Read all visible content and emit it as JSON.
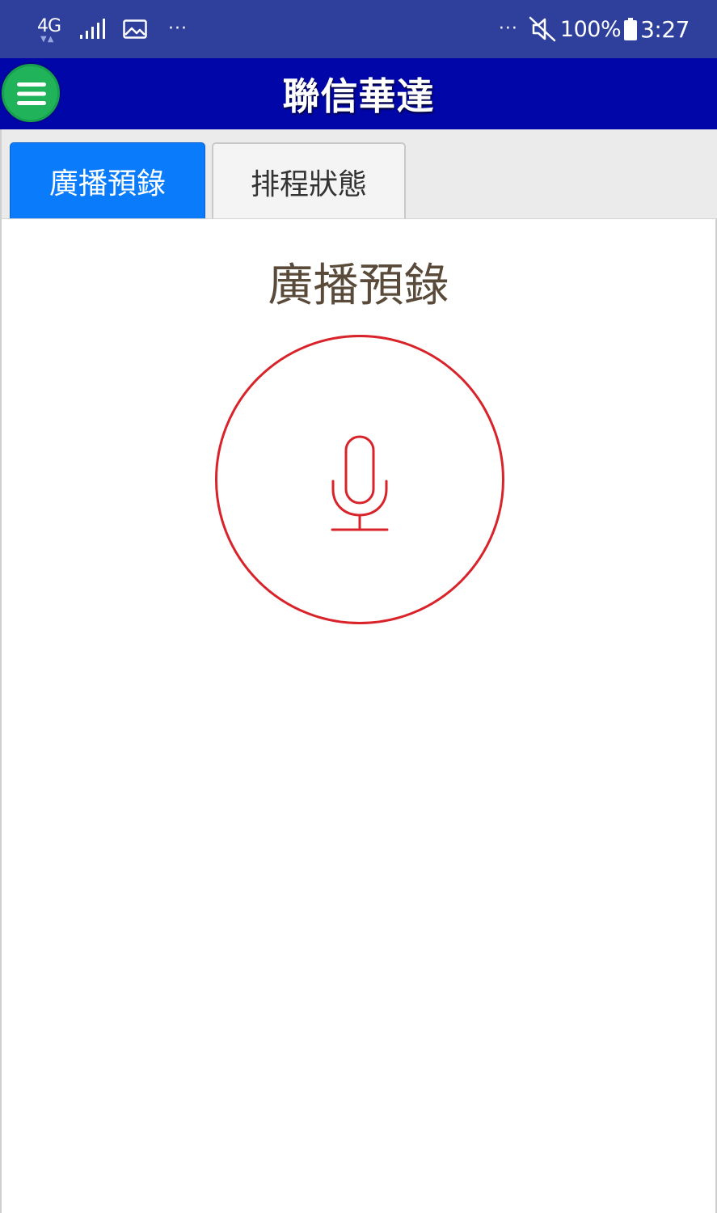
{
  "status_bar": {
    "network_type": "4G",
    "network_arrows": "▼▲",
    "left_dots": "···",
    "right_dots": "···",
    "battery_percent": "100%",
    "time": "3:27",
    "icons": {
      "network": "4g-icon",
      "signal": "signal-strength-icon",
      "image": "gallery-notification-icon",
      "mute": "vibrate-off-icon",
      "battery": "battery-icon"
    }
  },
  "header": {
    "title": "聯信華達",
    "menu_icon": "hamburger-menu-icon",
    "background_color": "#0006a8",
    "menu_button_color": "#20b35a"
  },
  "tabs": [
    {
      "label": "廣播預錄",
      "active": true
    },
    {
      "label": "排程狀態",
      "active": false
    }
  ],
  "main": {
    "title": "廣播預錄",
    "record_icon": "microphone-icon",
    "accent_color": "#d8232a",
    "active_tab_color": "#0a7cfb"
  }
}
